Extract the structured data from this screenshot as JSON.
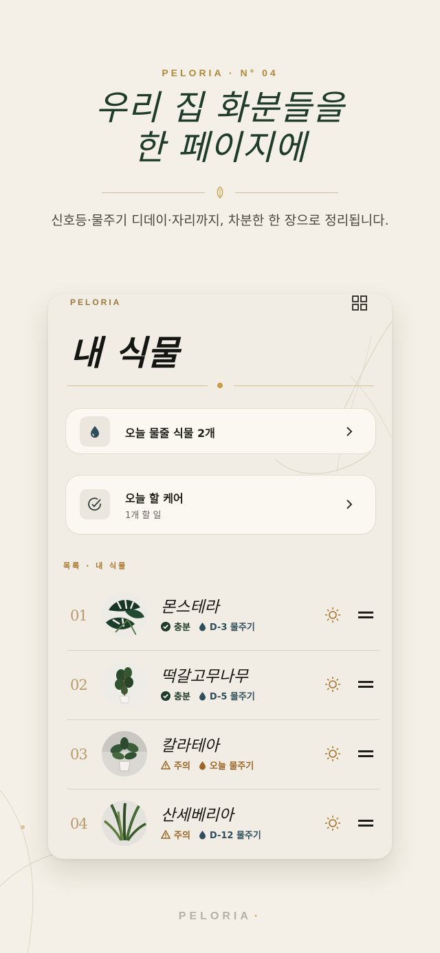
{
  "header": {
    "eyebrow": "PELORIA · N° 04",
    "title_line1": "우리 집 화분들을",
    "title_line2": "한 페이지에",
    "subtitle": "신호등·물주기 디데이·자리까지, 차분한 한 장으로 정리됩니다."
  },
  "card": {
    "brand": "PELORIA",
    "title": "내 식물",
    "grid_icon": "grid-icon",
    "water_tile": {
      "icon": "water-drop-icon",
      "label": "오늘 물줄 식물 2개"
    },
    "care_tile": {
      "icon": "check-circle-icon",
      "label": "오늘 할 케어",
      "sub": "1개 할 일"
    },
    "section_label": "목록 · 내 식물",
    "plants": [
      {
        "num": "01",
        "name": "몬스테라",
        "status": "충분",
        "status_type": "good",
        "water": "D-3 물주기",
        "water_type": "sched",
        "photo": "monstera"
      },
      {
        "num": "02",
        "name": "떡갈고무나무",
        "status": "충분",
        "status_type": "good",
        "water": "D-5 물주기",
        "water_type": "sched",
        "photo": "fiddle-leaf-fig"
      },
      {
        "num": "03",
        "name": "칼라테아",
        "status": "주의",
        "status_type": "warn",
        "water": "오늘 물주기",
        "water_type": "today",
        "photo": "calathea"
      },
      {
        "num": "04",
        "name": "산세베리아",
        "status": "주의",
        "status_type": "warn",
        "water": "D-12 물주기",
        "water_type": "sched",
        "photo": "sansevieria"
      }
    ]
  },
  "footer": {
    "brand": "PELORIA",
    "dot": "·"
  },
  "colors": {
    "background": "#f4f0e7",
    "accent_gold": "#b0883a",
    "forest_green": "#1f3b2a",
    "warn_brown": "#9c6527",
    "water_blue": "#2f4e5c"
  }
}
